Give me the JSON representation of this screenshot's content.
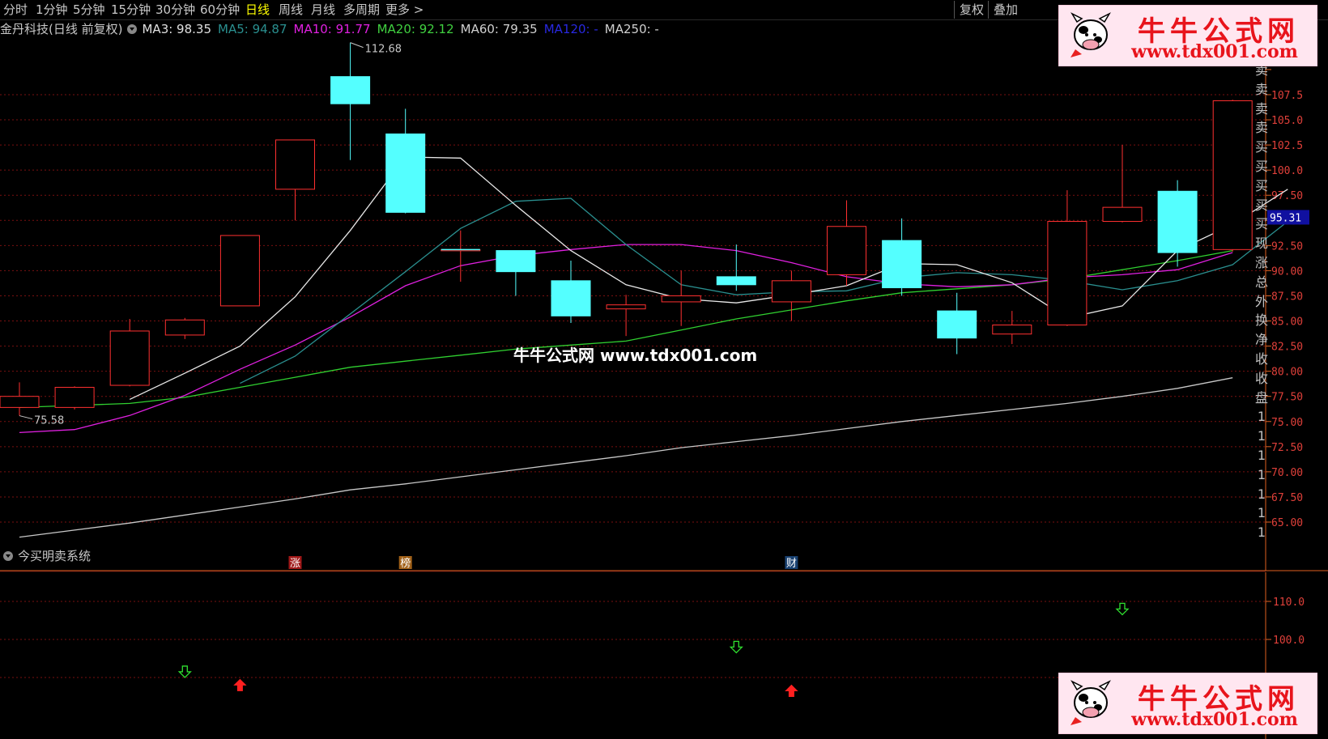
{
  "tabs": [
    "分时",
    "1分钟",
    "5分钟",
    "15分钟",
    "30分钟",
    "60分钟",
    "日线",
    "周线",
    "月线",
    "多周期",
    "更多 >"
  ],
  "active_tab": "日线",
  "right_buttons": [
    "复权",
    "叠加"
  ],
  "stock_title": "金丹科技(日线 前复权)",
  "ma_info": [
    {
      "label": "MA3: 98.35",
      "color": "#e0e0e0"
    },
    {
      "label": "MA5: 94.87",
      "color": "#2a8f8f"
    },
    {
      "label": "MA10: 91.77",
      "color": "#e020e0"
    },
    {
      "label": "MA20: 92.12",
      "color": "#40d040"
    },
    {
      "label": "MA60: 79.35",
      "color": "#d0d0d0"
    },
    {
      "label": "MA120: -",
      "color": "#2828e0"
    },
    {
      "label": "MA250: -",
      "color": "#d0d0d0"
    }
  ],
  "price_ticks": [
    "107.5",
    "105.0",
    "102.5",
    "100.0",
    "97.50",
    "95.00",
    "92.50",
    "90.00",
    "87.50",
    "85.00",
    "82.50",
    "80.00",
    "77.50",
    "75.00",
    "72.50",
    "70.00",
    "67.50",
    "65.00"
  ],
  "price_tick_values": [
    107.5,
    105,
    102.5,
    100,
    97.5,
    95,
    92.5,
    90,
    87.5,
    85,
    82.5,
    80,
    77.5,
    75,
    72.5,
    70,
    67.5,
    65
  ],
  "current_price_label": "95.31",
  "current_price": 95.31,
  "high_label": "112.68",
  "low_label": "75.58",
  "colors": {
    "up": "#ff3030",
    "down": "#54ffff",
    "background": "#000000",
    "axis": "#e06020",
    "ma3": "#e8e8e8",
    "ma5": "#2a8f8f",
    "ma10": "#e020e0",
    "ma20": "#30d030",
    "ma60": "#c8c8c8"
  },
  "candles": [
    {
      "o": 76.4,
      "h": 78.9,
      "l": 75.58,
      "c": 77.5
    },
    {
      "o": 76.4,
      "h": 78.5,
      "l": 76.2,
      "c": 78.4
    },
    {
      "o": 78.6,
      "h": 85.2,
      "l": 78.5,
      "c": 84.0
    },
    {
      "o": 83.6,
      "h": 85.3,
      "l": 83.2,
      "c": 85.1
    },
    {
      "o": 86.5,
      "h": 93.5,
      "l": 86.5,
      "c": 93.5
    },
    {
      "o": 98.1,
      "h": 103.0,
      "l": 95.0,
      "c": 103.0
    },
    {
      "o": 109.3,
      "h": 112.68,
      "l": 101.0,
      "c": 106.6
    },
    {
      "o": 103.6,
      "h": 106.1,
      "l": 95.7,
      "c": 95.8
    },
    {
      "o": 92.1,
      "h": 94.0,
      "l": 88.9,
      "c": 92.1
    },
    {
      "o": 92.0,
      "h": 92.0,
      "l": 87.5,
      "c": 89.9
    },
    {
      "o": 89.0,
      "h": 91.0,
      "l": 84.8,
      "c": 85.5
    },
    {
      "o": 86.2,
      "h": 87.6,
      "l": 83.5,
      "c": 86.6
    },
    {
      "o": 86.9,
      "h": 90.0,
      "l": 84.5,
      "c": 87.5
    },
    {
      "o": 89.4,
      "h": 92.6,
      "l": 88.0,
      "c": 88.6
    },
    {
      "o": 86.9,
      "h": 90.0,
      "l": 85.0,
      "c": 89.0
    },
    {
      "o": 89.6,
      "h": 97.0,
      "l": 88.5,
      "c": 94.4
    },
    {
      "o": 93.0,
      "h": 95.2,
      "l": 87.5,
      "c": 88.3
    },
    {
      "o": 86.0,
      "h": 87.8,
      "l": 81.7,
      "c": 83.3
    },
    {
      "o": 83.7,
      "h": 86.0,
      "l": 82.7,
      "c": 84.6
    },
    {
      "o": 84.6,
      "h": 98.0,
      "l": 84.5,
      "c": 94.9
    },
    {
      "o": 94.9,
      "h": 102.5,
      "l": 94.8,
      "c": 96.3
    },
    {
      "o": 97.9,
      "h": 99.0,
      "l": 90.4,
      "c": 91.8
    },
    {
      "o": 92.1,
      "h": 107.0,
      "l": 91.9,
      "c": 106.9
    }
  ],
  "ma3": [
    null,
    null,
    77.2,
    79.8,
    82.5,
    87.4,
    94.0,
    101.3,
    101.2,
    96.5,
    92.0,
    88.6,
    87.2,
    86.8,
    87.6,
    88.5,
    90.7,
    90.6,
    88.8,
    85.3,
    86.5,
    92.0,
    94.6,
    98.1
  ],
  "ma5": [
    null,
    null,
    null,
    null,
    78.8,
    81.5,
    85.7,
    89.9,
    94.2,
    96.9,
    97.2,
    92.6,
    88.6,
    87.6,
    87.9,
    88.0,
    89.3,
    89.8,
    89.6,
    89.0,
    88.1,
    89.0,
    90.6,
    94.9
  ],
  "ma10": [
    73.9,
    74.2,
    75.6,
    77.6,
    80.2,
    82.6,
    85.4,
    88.5,
    90.5,
    91.5,
    92.1,
    92.6,
    92.6,
    92.0,
    90.8,
    89.4,
    88.7,
    88.4,
    88.6,
    89.3,
    89.6,
    90.1,
    91.8
  ],
  "ma20": [
    76.4,
    76.6,
    76.8,
    77.4,
    78.4,
    79.4,
    80.4,
    81.0,
    81.6,
    82.2,
    82.6,
    83.0,
    84.1,
    85.2,
    86.1,
    87.0,
    87.8,
    88.2,
    88.6,
    89.2,
    90.1,
    91.0,
    92.0
  ],
  "ma60": [
    63.5,
    64.2,
    64.9,
    65.7,
    66.5,
    67.3,
    68.2,
    68.8,
    69.5,
    70.2,
    70.9,
    71.6,
    72.4,
    73.0,
    73.6,
    74.3,
    75.0,
    75.6,
    76.2,
    76.8,
    77.5,
    78.3,
    79.35
  ],
  "markers": [
    {
      "candle": 5,
      "text": "涨",
      "bg": "#a01818"
    },
    {
      "candle": 7,
      "text": "榜",
      "bg": "#a06018"
    },
    {
      "candle": 14,
      "text": "财",
      "bg": "#184070"
    }
  ],
  "indicator": {
    "title": "今买明卖系统",
    "ticks": [
      "110.0",
      "100.0"
    ],
    "tick_values": [
      110,
      100
    ],
    "signals": [
      {
        "candle": 3,
        "type": "sell",
        "value": 91.5
      },
      {
        "candle": 4,
        "type": "buy",
        "value": 88.0
      },
      {
        "candle": 13,
        "type": "sell",
        "value": 98.0
      },
      {
        "candle": 14,
        "type": "buy",
        "value": 86.5
      },
      {
        "candle": 20,
        "type": "sell",
        "value": 108.0
      }
    ]
  },
  "side_chars": [
    "卖",
    "卖",
    "卖",
    "卖",
    "买",
    "买",
    "买",
    "买",
    "买",
    "现",
    "涨",
    "总",
    "外",
    "换",
    "净",
    "收",
    "收",
    "盘",
    "1",
    "1",
    "1",
    "1",
    "1",
    "1",
    "1"
  ],
  "watermark": {
    "title": "牛牛公式网",
    "url": "www.tdx001.com"
  },
  "center_watermark": "牛牛公式网 www.tdx001.com"
}
